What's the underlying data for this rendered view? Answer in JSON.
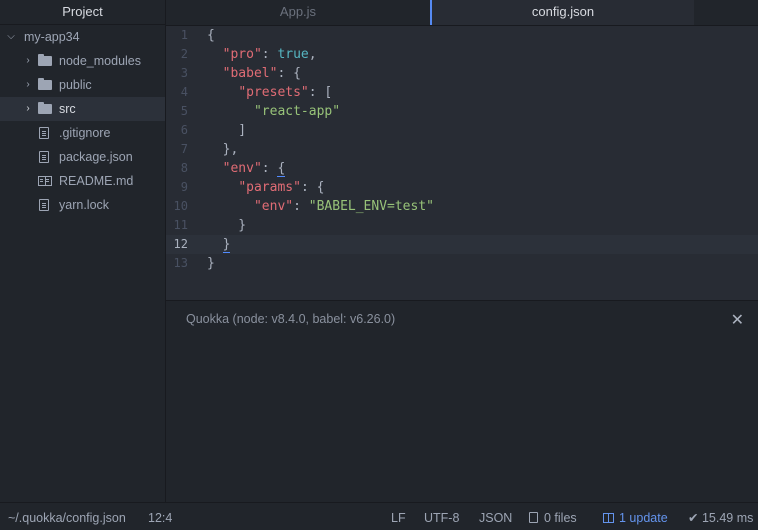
{
  "sidebar": {
    "title": "Project",
    "tree": [
      {
        "name": "my-app34",
        "kind": "root",
        "chevron": "v",
        "icon": "none"
      },
      {
        "name": "node_modules",
        "kind": "folder",
        "chevron": ">",
        "icon": "folder-icon"
      },
      {
        "name": "public",
        "kind": "folder",
        "chevron": ">",
        "icon": "folder-icon"
      },
      {
        "name": "src",
        "kind": "folder",
        "chevron": ">",
        "icon": "folder-icon",
        "selected": true
      },
      {
        "name": ".gitignore",
        "kind": "file",
        "icon": "file-icon"
      },
      {
        "name": "package.json",
        "kind": "file",
        "icon": "file-icon"
      },
      {
        "name": "README.md",
        "kind": "file",
        "icon": "book-icon"
      },
      {
        "name": "yarn.lock",
        "kind": "file",
        "icon": "file-icon"
      }
    ]
  },
  "tabs": [
    {
      "label": "App.js",
      "active": false
    },
    {
      "label": "config.json",
      "active": true
    }
  ],
  "editor": {
    "cursor_line": 12,
    "lines": [
      {
        "n": "1",
        "tokens": [
          {
            "t": "{",
            "c": "punc"
          }
        ]
      },
      {
        "n": "2",
        "tokens": [
          {
            "t": "  ",
            "c": "punc"
          },
          {
            "t": "\"pro\"",
            "c": "key"
          },
          {
            "t": ": ",
            "c": "punc"
          },
          {
            "t": "true",
            "c": "bool"
          },
          {
            "t": ",",
            "c": "punc"
          }
        ]
      },
      {
        "n": "3",
        "tokens": [
          {
            "t": "  ",
            "c": "punc"
          },
          {
            "t": "\"babel\"",
            "c": "key"
          },
          {
            "t": ": {",
            "c": "punc"
          }
        ]
      },
      {
        "n": "4",
        "tokens": [
          {
            "t": "    ",
            "c": "punc"
          },
          {
            "t": "\"presets\"",
            "c": "key"
          },
          {
            "t": ": [",
            "c": "punc"
          }
        ]
      },
      {
        "n": "5",
        "tokens": [
          {
            "t": "      ",
            "c": "punc"
          },
          {
            "t": "\"react-app\"",
            "c": "str"
          }
        ]
      },
      {
        "n": "6",
        "tokens": [
          {
            "t": "    ]",
            "c": "punc"
          }
        ]
      },
      {
        "n": "7",
        "tokens": [
          {
            "t": "  },",
            "c": "punc"
          }
        ]
      },
      {
        "n": "8",
        "tokens": [
          {
            "t": "  ",
            "c": "punc"
          },
          {
            "t": "\"env\"",
            "c": "key"
          },
          {
            "t": ": ",
            "c": "punc"
          },
          {
            "t": "{",
            "c": "match"
          }
        ]
      },
      {
        "n": "9",
        "tokens": [
          {
            "t": "    ",
            "c": "punc"
          },
          {
            "t": "\"params\"",
            "c": "key"
          },
          {
            "t": ": {",
            "c": "punc"
          }
        ]
      },
      {
        "n": "10",
        "tokens": [
          {
            "t": "      ",
            "c": "punc"
          },
          {
            "t": "\"env\"",
            "c": "key"
          },
          {
            "t": ": ",
            "c": "punc"
          },
          {
            "t": "\"BABEL_ENV=test\"",
            "c": "str"
          }
        ]
      },
      {
        "n": "11",
        "tokens": [
          {
            "t": "    }",
            "c": "punc"
          }
        ]
      },
      {
        "n": "12",
        "tokens": [
          {
            "t": "  ",
            "c": "punc"
          },
          {
            "t": "}",
            "c": "match"
          }
        ]
      },
      {
        "n": "13",
        "tokens": [
          {
            "t": "}",
            "c": "punc"
          }
        ]
      }
    ]
  },
  "quokka": {
    "title": "Quokka (node: v8.4.0, babel: v6.26.0)",
    "close_glyph": "✕"
  },
  "statusbar": {
    "path": "~/.quokka/config.json",
    "position": "12:4",
    "line_ending": "LF",
    "encoding": "UTF-8",
    "grammar": "JSON",
    "files": "0 files",
    "update": "1 update",
    "timing": "✔ 15.49 ms"
  },
  "colors": {
    "accent": "#568af2",
    "key": "#e06c75",
    "string": "#98c379",
    "boolean": "#56b6c2"
  }
}
